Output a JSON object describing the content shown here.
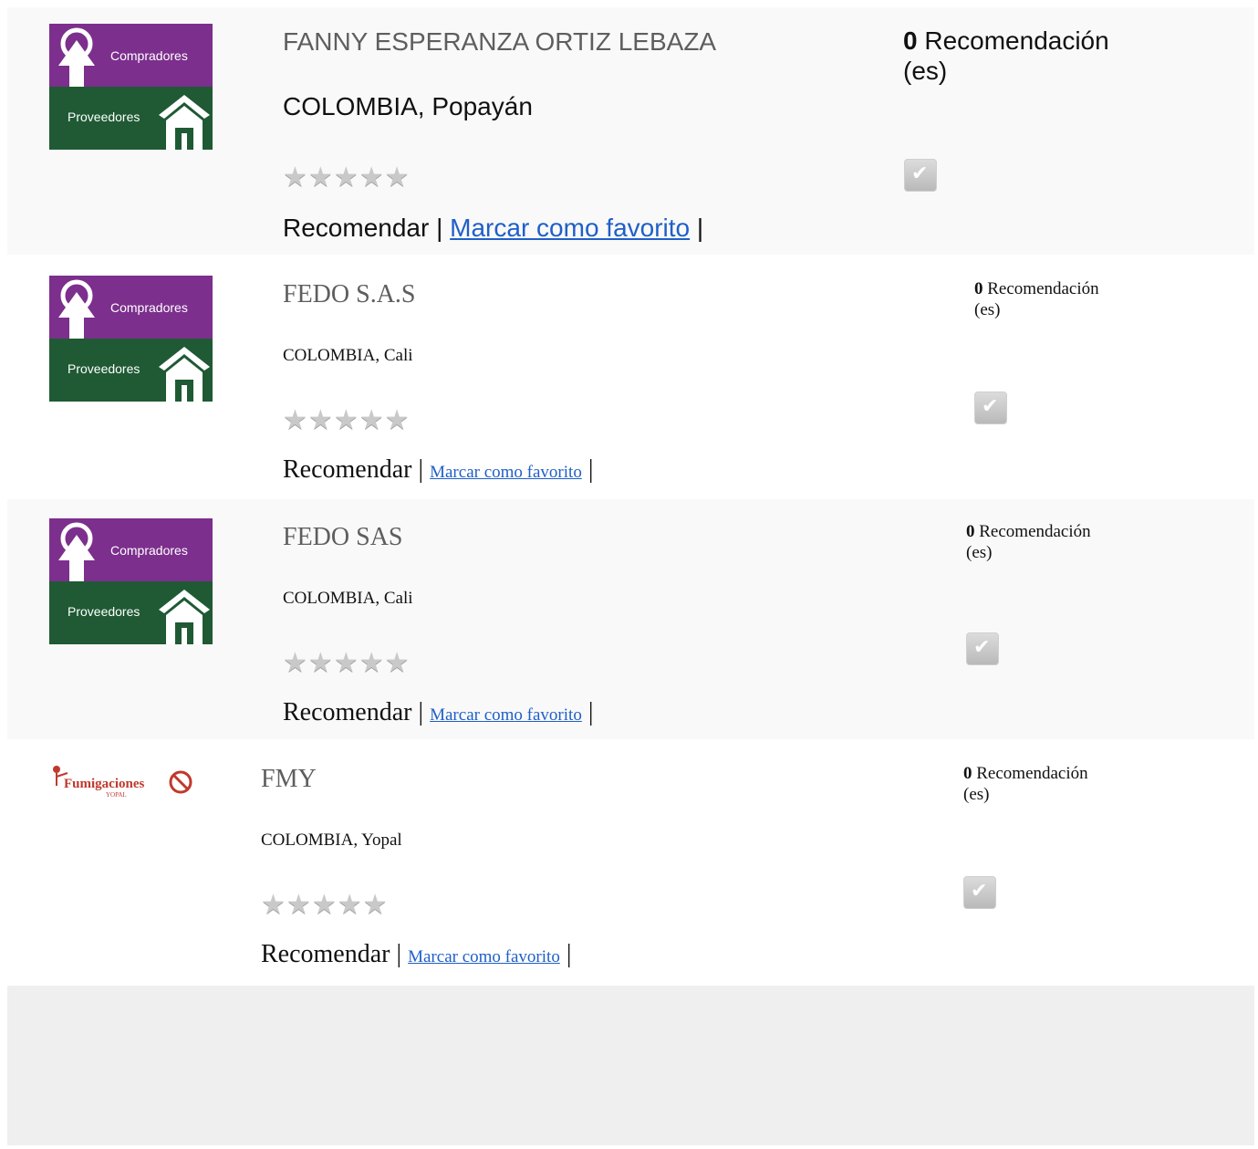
{
  "logo": {
    "purple_text": "Compradores",
    "green_text": "Proveedores"
  },
  "fum_logo": {
    "text": "Fumigaciones",
    "sub": "YOPAL"
  },
  "listings": [
    {
      "name": "FANNY ESPERANZA ORTIZ LEBAZA",
      "location": "COLOMBIA, Popayán",
      "recommend": "Recomendar",
      "separator": "|",
      "favorite": "Marcar como favorito",
      "separator_end": "|",
      "reco_count": "0",
      "reco_label": "Recomendación",
      "reco_suffix": "(es)",
      "stars": 0
    },
    {
      "name": "FEDO S.A.S",
      "location": "COLOMBIA, Cali",
      "recommend": "Recomendar",
      "separator": "|",
      "favorite": "Marcar como favorito",
      "separator_end": "|",
      "reco_count": "0",
      "reco_label": "Recomendación",
      "reco_suffix": "(es)",
      "stars": 0
    },
    {
      "name": "FEDO SAS",
      "location": "COLOMBIA, Cali",
      "recommend": "Recomendar",
      "separator": "|",
      "favorite": "Marcar como favorito",
      "separator_end": "|",
      "reco_count": "0",
      "reco_label": "Recomendación",
      "reco_suffix": "(es)",
      "stars": 0
    },
    {
      "name": "FMY",
      "location": "COLOMBIA, Yopal",
      "recommend": "Recomendar",
      "separator": "|",
      "favorite": "Marcar como favorito",
      "separator_end": "|",
      "reco_count": "0",
      "reco_label": "Recomendación",
      "reco_suffix": "(es)",
      "stars": 0
    }
  ],
  "colors": {
    "logo_purple": "#7c2f8c",
    "logo_green": "#1f5a34",
    "link": "#1f5fc8",
    "row_alt": "#f9f9f9",
    "footer_bg": "#efefef"
  }
}
